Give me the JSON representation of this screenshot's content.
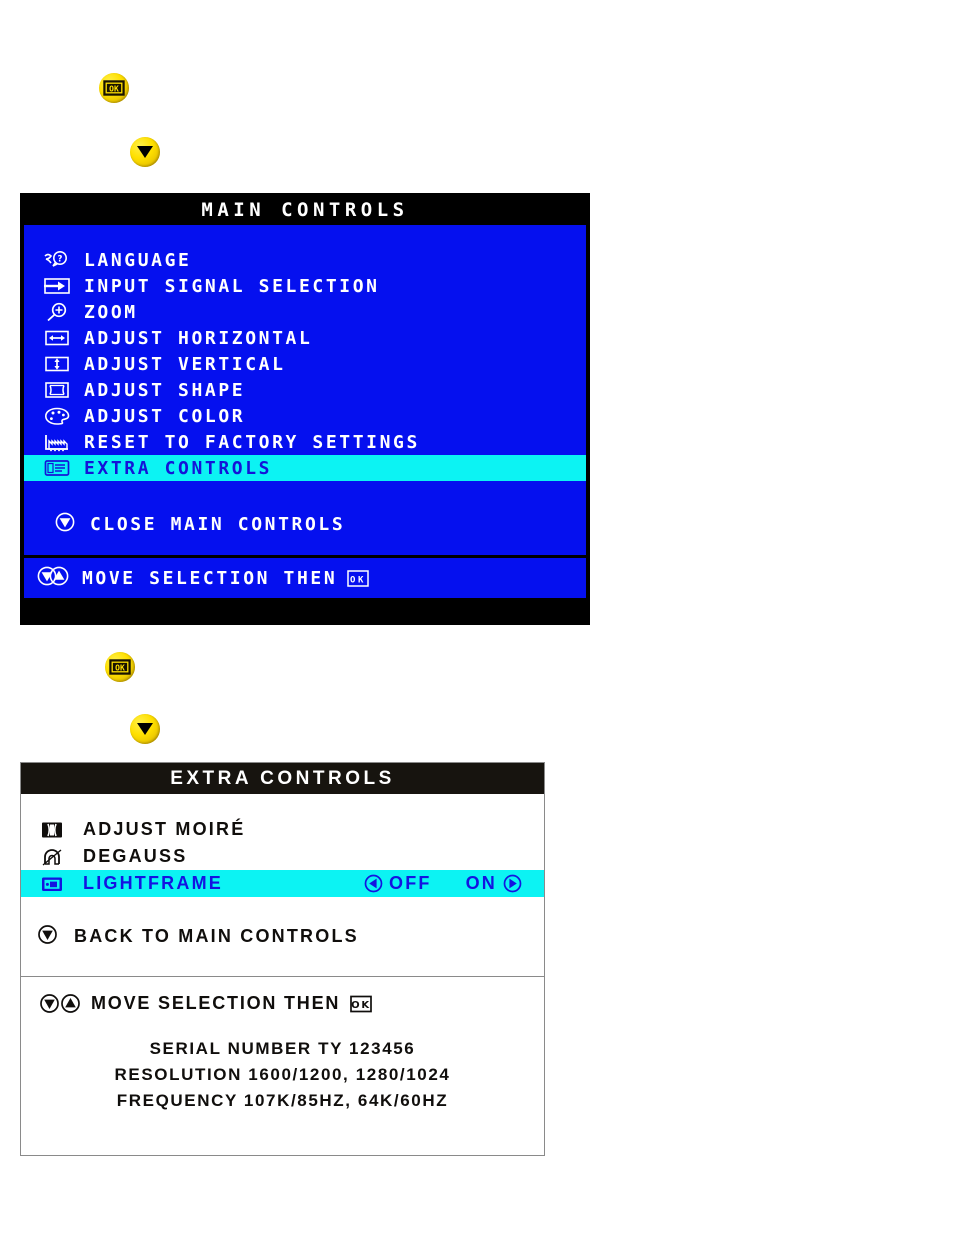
{
  "keys": {
    "ok_top": {
      "icon": "ok-key-icon",
      "label": "OK"
    },
    "down_top": {
      "icon": "down-arrow-key-icon",
      "label": "DOWN"
    },
    "ok_mid": {
      "icon": "ok-key-icon",
      "label": "OK"
    },
    "down_mid": {
      "icon": "down-arrow-key-icon",
      "label": "DOWN"
    }
  },
  "main_controls": {
    "title": "MAIN CONTROLS",
    "items": [
      {
        "icon": "language-icon",
        "label": "LANGUAGE",
        "selected": false
      },
      {
        "icon": "input-signal-icon",
        "label": "INPUT SIGNAL SELECTION",
        "selected": false
      },
      {
        "icon": "magnifier-zoom-icon",
        "label": "ZOOM",
        "selected": false
      },
      {
        "icon": "adjust-horizontal-icon",
        "label": "ADJUST HORIZONTAL",
        "selected": false
      },
      {
        "icon": "adjust-vertical-icon",
        "label": "ADJUST VERTICAL",
        "selected": false
      },
      {
        "icon": "adjust-shape-icon",
        "label": "ADJUST SHAPE",
        "selected": false
      },
      {
        "icon": "adjust-color-icon",
        "label": "ADJUST COLOR",
        "selected": false
      },
      {
        "icon": "factory-reset-icon",
        "label": "RESET TO FACTORY SETTINGS",
        "selected": false
      },
      {
        "icon": "extra-controls-icon",
        "label": "EXTRA CONTROLS",
        "selected": true
      }
    ],
    "close_item": {
      "icon": "down-arrow-icon",
      "label": "CLOSE MAIN CONTROLS"
    },
    "footer": {
      "icon_down": "down-arrow-icon",
      "icon_up": "up-arrow-icon",
      "label": "MOVE SELECTION THEN",
      "icon_ok": "ok-icon"
    },
    "colors": {
      "background": "#0510ef",
      "title_bar": "#000000",
      "highlight": "#0cf3f3",
      "highlight_text": "#1414d8",
      "text": "#ffffff"
    }
  },
  "extra_controls": {
    "title": "EXTRA CONTROLS",
    "items": [
      {
        "icon": "moire-icon",
        "label": "ADJUST MOIRÉ",
        "selected": false,
        "options": []
      },
      {
        "icon": "degauss-icon",
        "label": "DEGAUSS",
        "selected": false,
        "options": []
      },
      {
        "icon": "lightframe-icon",
        "label": "LIGHTFRAME",
        "selected": true,
        "options": [
          "OFF",
          "ON"
        ]
      }
    ],
    "back_item": {
      "icon": "down-arrow-icon",
      "label": "BACK TO MAIN CONTROLS"
    },
    "footer": {
      "icon_down": "down-arrow-icon",
      "icon_up": "up-arrow-icon",
      "label": "MOVE SELECTION THEN",
      "icon_ok": "ok-icon"
    },
    "info": {
      "serial": "SERIAL NUMBER TY 123456",
      "resolution": "RESOLUTION 1600/1200, 1280/1024",
      "frequency": "FREQUENCY 107K/85HZ, 64K/60HZ"
    },
    "colors": {
      "background": "#ffffff",
      "title_bar": "#17140f",
      "highlight": "#0cf3f3",
      "highlight_text": "#1414e0",
      "text": "#100e0c",
      "border": "#8a8a8a"
    }
  }
}
